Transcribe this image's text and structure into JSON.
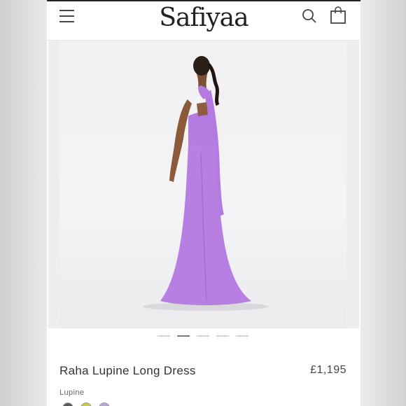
{
  "header": {
    "brand": "Safiyaa",
    "menu_icon": "hamburger-menu-icon",
    "search_icon": "search-icon",
    "bag_icon": "shopping-bag-icon"
  },
  "gallery": {
    "image_count": 5,
    "active_index": 1
  },
  "product": {
    "name": "Raha Lupine Long Dress",
    "price": "£1,195",
    "color_label": "Lupine",
    "swatch_colors": [
      "#5a5a5a",
      "#c9c94a",
      "#b7a9d6"
    ]
  },
  "colors": {
    "dress": "#b97fe3",
    "text": "#333333"
  }
}
